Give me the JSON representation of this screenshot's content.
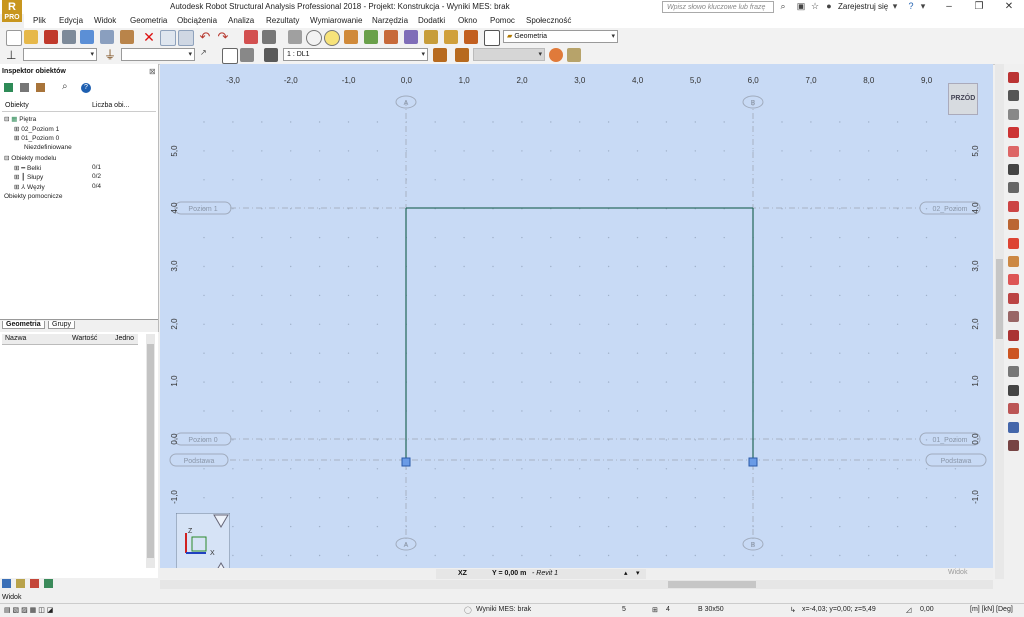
{
  "app": {
    "logo_text": "PRO",
    "title": "Autodesk Robot Structural Analysis Professional 2018 - Projekt: Konstrukcja - Wyniki MES: brak",
    "search_placeholder": "Wpisz słowo kluczowe lub frazę",
    "register_label": "Zarejestruj się"
  },
  "menu": [
    "Plik",
    "Edycja",
    "Widok",
    "Geometria",
    "Obciążenia",
    "Analiza",
    "Rezultaty",
    "Wymiarowanie",
    "Narzędzia",
    "Dodatki",
    "Okno",
    "Pomoc",
    "Społeczność"
  ],
  "toolbar": {
    "layout_combo": "Geometria",
    "load_case_combo": "1 : DL1"
  },
  "inspector": {
    "title": "Inspektor obiektów",
    "col_objects": "Obiekty",
    "col_count": "Liczba obi...",
    "tree": [
      {
        "label": "Piętra",
        "count": "",
        "indent": 0,
        "expander": "⊟"
      },
      {
        "label": "02_Poziom 1",
        "count": "",
        "indent": 1,
        "expander": "⊞"
      },
      {
        "label": "01_Poziom 0",
        "count": "",
        "indent": 1,
        "expander": "⊞"
      },
      {
        "label": "Niezdefiniowane",
        "count": "",
        "indent": 2,
        "expander": ""
      },
      {
        "label": "Obiekty modelu",
        "count": "",
        "indent": 0,
        "expander": "⊟"
      },
      {
        "label": "Belki",
        "count": "0/1",
        "indent": 1,
        "expander": "⊞"
      },
      {
        "label": "Słupy",
        "count": "0/2",
        "indent": 1,
        "expander": "⊞"
      },
      {
        "label": "Węzły",
        "count": "0/4",
        "indent": 1,
        "expander": "⊞"
      },
      {
        "label": "Obiekty pomocnicze",
        "count": "",
        "indent": 0,
        "expander": ""
      }
    ],
    "tabs": [
      "Geometria",
      "Grupy"
    ],
    "props_cols": [
      "Nazwa",
      "Wartość",
      "Jedno"
    ]
  },
  "canvas": {
    "x_ticks": [
      "-3,0",
      "-2,0",
      "-1,0",
      "0,0",
      "1,0",
      "2,0",
      "3,0",
      "4,0",
      "5,0",
      "6,0",
      "7,0",
      "8,0",
      "9,0"
    ],
    "y_ticks": [
      "5,0",
      "4,0",
      "3,0",
      "2,0",
      "1,0",
      "0,0",
      "-1,0"
    ],
    "axis_a": "A",
    "axis_b": "B",
    "level1_left": "Poziom 1",
    "level1_right": "02_Poziom",
    "level0_left": "Poziom 0",
    "level0_right": "01_Poziom",
    "base_left": "Podstawa",
    "base_right": "Podstawa",
    "front_button": "PRZÓD",
    "view_plane": "XZ",
    "view_position": "Y = 0,00 m",
    "view_position_suffix": "- Revit 1",
    "bottom_right_label": "Widok",
    "frame_color": "#2e6e63",
    "canvas_bg": "#c8daf5"
  },
  "left_bottom": {
    "view_label": "Widok"
  },
  "status": {
    "results": "Wyniki MES: brak",
    "val1": "5",
    "val2": "4",
    "section": "B 30x50",
    "coords": "x=-4,03; y=0,00; z=5,49",
    "angle": "0,00",
    "units": "[m] [kN] [Deg]"
  }
}
